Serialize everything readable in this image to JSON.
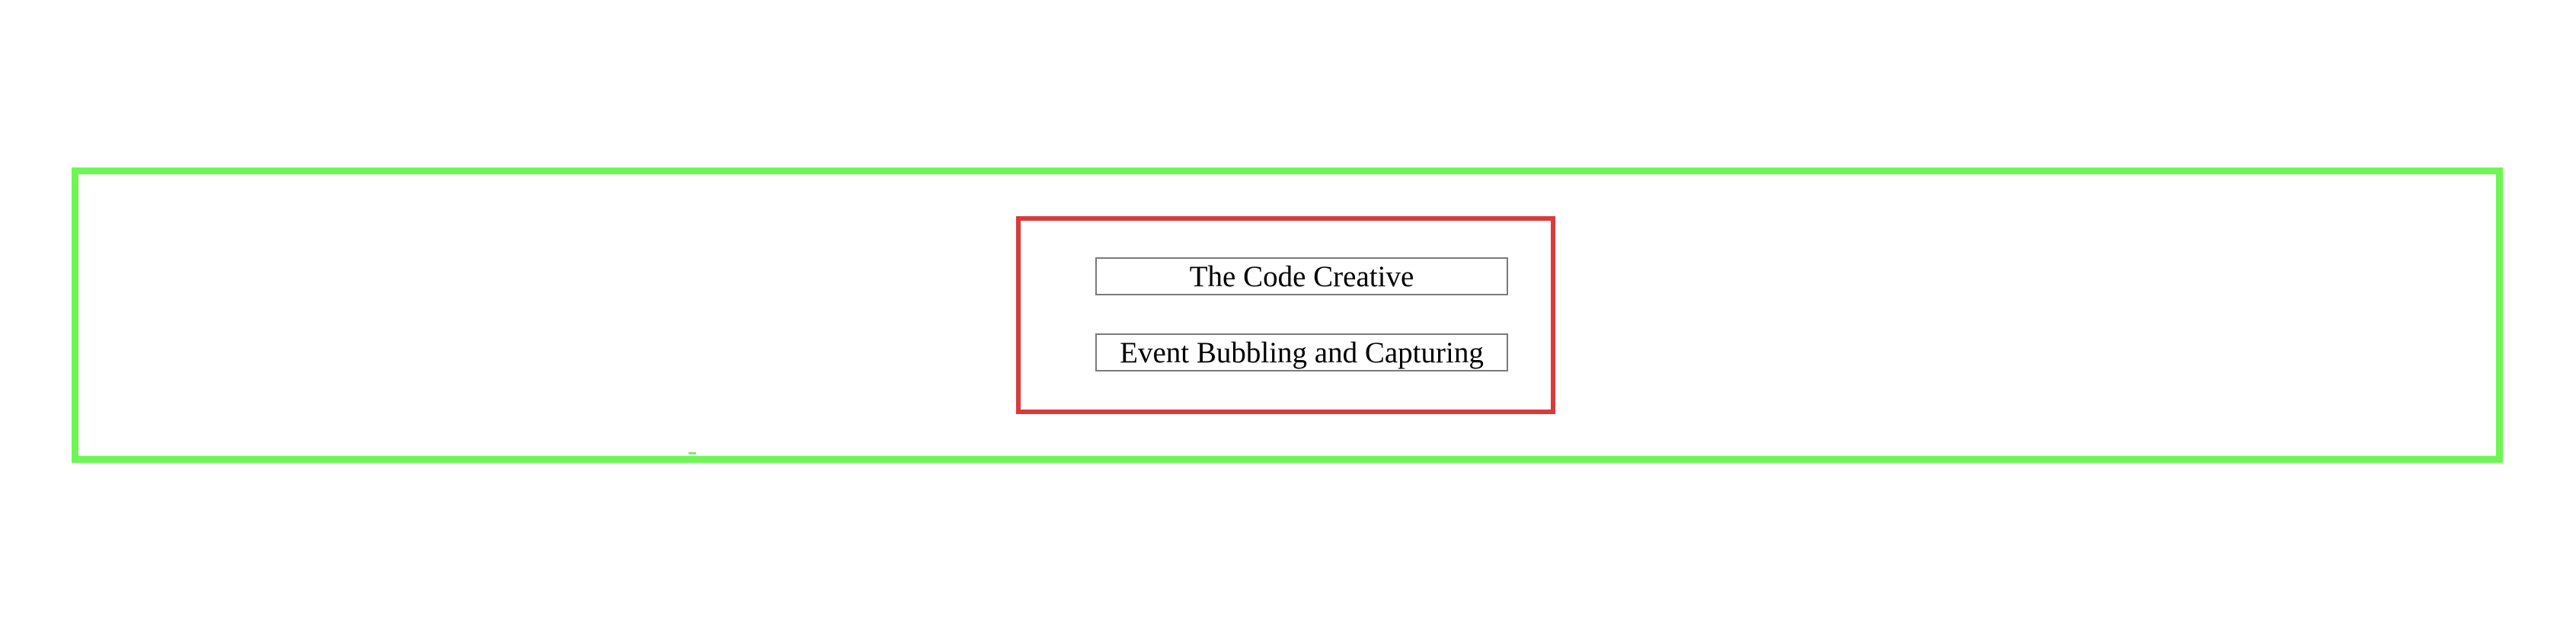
{
  "colors": {
    "outer_border": "#6ef754",
    "inner_border": "#d93a3a",
    "text_box_border": "#7a7a7a",
    "background": "#ffffff"
  },
  "page": {
    "items": [
      {
        "label": "The Code Creative"
      },
      {
        "label": "Event Bubbling and Capturing"
      }
    ]
  }
}
